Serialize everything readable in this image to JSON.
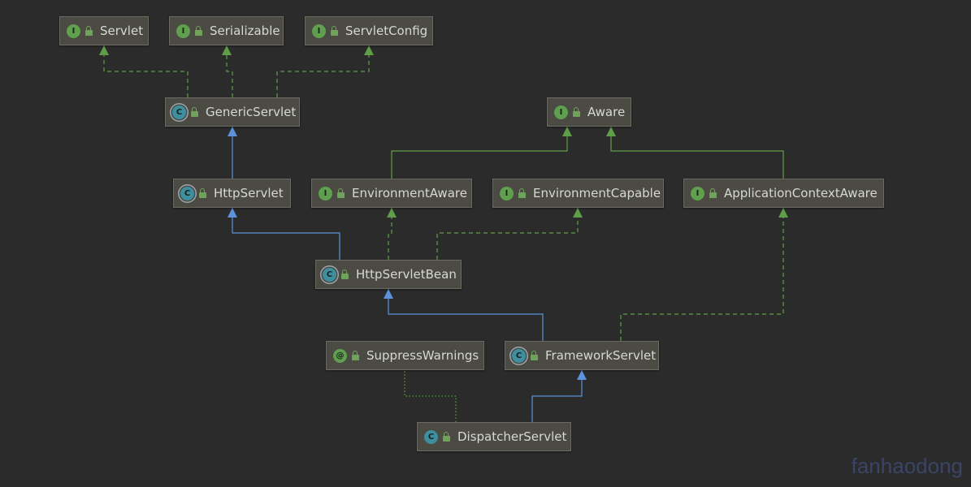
{
  "nodes": [
    {
      "id": "servlet",
      "label": "Servlet",
      "kind": "interface",
      "icon_letter": "I"
    },
    {
      "id": "serializable",
      "label": "Serializable",
      "kind": "interface",
      "icon_letter": "I"
    },
    {
      "id": "servlet-config",
      "label": "ServletConfig",
      "kind": "interface",
      "icon_letter": "I"
    },
    {
      "id": "generic-servlet",
      "label": "GenericServlet",
      "kind": "abstract",
      "icon_letter": "C"
    },
    {
      "id": "aware",
      "label": "Aware",
      "kind": "interface",
      "icon_letter": "I"
    },
    {
      "id": "http-servlet",
      "label": "HttpServlet",
      "kind": "abstract",
      "icon_letter": "C"
    },
    {
      "id": "environment-aware",
      "label": "EnvironmentAware",
      "kind": "interface",
      "icon_letter": "I"
    },
    {
      "id": "environment-capable",
      "label": "EnvironmentCapable",
      "kind": "interface",
      "icon_letter": "I"
    },
    {
      "id": "application-context-aware",
      "label": "ApplicationContextAware",
      "kind": "interface",
      "icon_letter": "I"
    },
    {
      "id": "http-servlet-bean",
      "label": "HttpServletBean",
      "kind": "abstract",
      "icon_letter": "C"
    },
    {
      "id": "suppress-warnings",
      "label": "SuppressWarnings",
      "kind": "annotation",
      "icon_letter": "@"
    },
    {
      "id": "framework-servlet",
      "label": "FrameworkServlet",
      "kind": "abstract",
      "icon_letter": "C"
    },
    {
      "id": "dispatcher-servlet",
      "label": "DispatcherServlet",
      "kind": "class",
      "icon_letter": "C"
    }
  ],
  "edges": [
    {
      "from": "generic-servlet",
      "to": "servlet",
      "type": "implements"
    },
    {
      "from": "generic-servlet",
      "to": "serializable",
      "type": "implements"
    },
    {
      "from": "generic-servlet",
      "to": "servlet-config",
      "type": "implements"
    },
    {
      "from": "http-servlet",
      "to": "generic-servlet",
      "type": "extends"
    },
    {
      "from": "environment-aware",
      "to": "aware",
      "type": "interface-extends"
    },
    {
      "from": "application-context-aware",
      "to": "aware",
      "type": "interface-extends"
    },
    {
      "from": "http-servlet-bean",
      "to": "http-servlet",
      "type": "extends"
    },
    {
      "from": "http-servlet-bean",
      "to": "environment-aware",
      "type": "implements"
    },
    {
      "from": "http-servlet-bean",
      "to": "environment-capable",
      "type": "implements"
    },
    {
      "from": "framework-servlet",
      "to": "http-servlet-bean",
      "type": "extends"
    },
    {
      "from": "framework-servlet",
      "to": "application-context-aware",
      "type": "implements"
    },
    {
      "from": "dispatcher-servlet",
      "to": "framework-servlet",
      "type": "extends"
    },
    {
      "from": "dispatcher-servlet",
      "to": "suppress-warnings",
      "type": "annotated-with"
    }
  ],
  "colors": {
    "extends": "#5c93dc",
    "implements": "#5f9e49",
    "interface_extends": "#5f9e49",
    "annotation_link": "#5f9e49"
  },
  "watermark": "fanhaodong"
}
